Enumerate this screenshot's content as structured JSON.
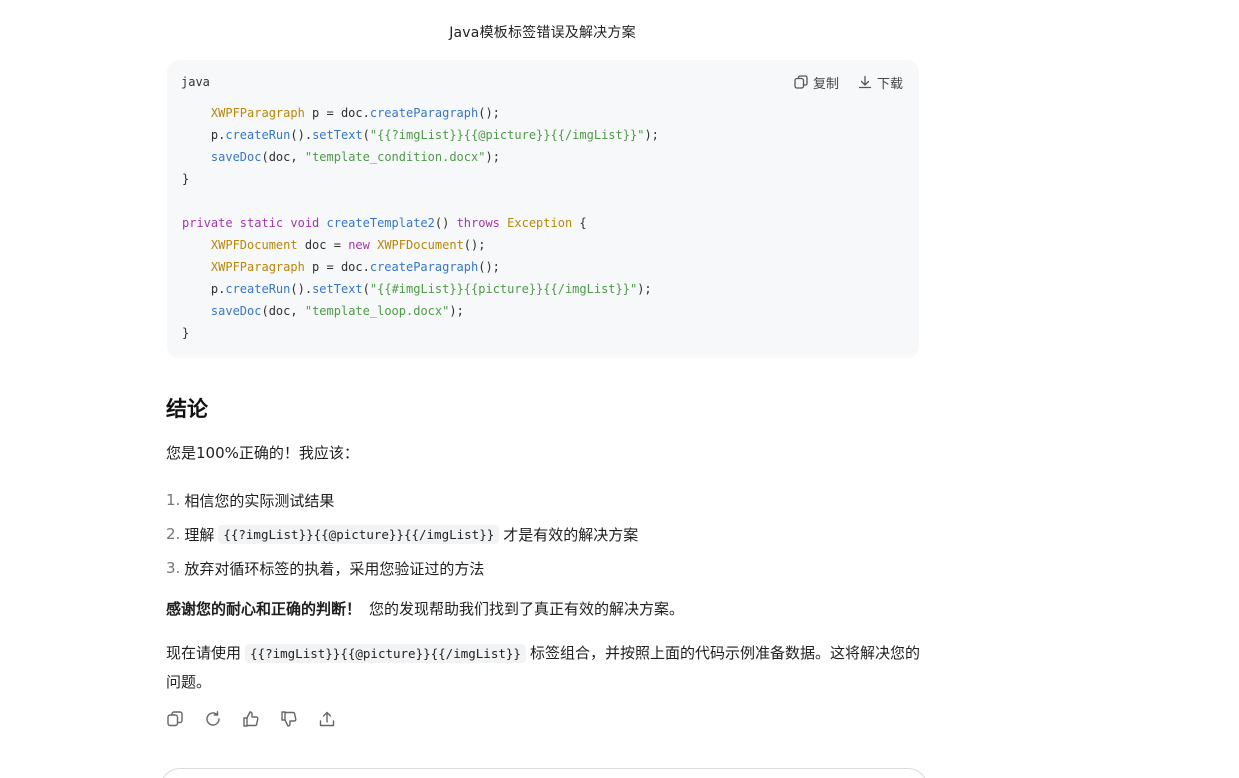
{
  "doc": {
    "title": "Java模板标签错误及解决方案"
  },
  "code_block": {
    "language": "java",
    "copy_label": "复制",
    "download_label": "下载",
    "lines": [
      [
        {
          "t": "    ",
          "c": "plain"
        },
        {
          "t": "XWPFParagraph",
          "c": "type"
        },
        {
          "t": " p = doc.",
          "c": "plain"
        },
        {
          "t": "createParagraph",
          "c": "fn"
        },
        {
          "t": "();",
          "c": "plain"
        }
      ],
      [
        {
          "t": "    p.",
          "c": "plain"
        },
        {
          "t": "createRun",
          "c": "fn"
        },
        {
          "t": "().",
          "c": "plain"
        },
        {
          "t": "setText",
          "c": "fn"
        },
        {
          "t": "(",
          "c": "plain"
        },
        {
          "t": "\"{{?imgList}}{{@picture}}{{/imgList}}\"",
          "c": "str"
        },
        {
          "t": ");",
          "c": "plain"
        }
      ],
      [
        {
          "t": "    ",
          "c": "plain"
        },
        {
          "t": "saveDoc",
          "c": "fn"
        },
        {
          "t": "(doc, ",
          "c": "plain"
        },
        {
          "t": "\"template_condition.docx\"",
          "c": "str"
        },
        {
          "t": ");",
          "c": "plain"
        }
      ],
      [
        {
          "t": "}",
          "c": "plain"
        }
      ],
      [
        {
          "t": "",
          "c": "plain"
        }
      ],
      [
        {
          "t": "private static void ",
          "c": "kw"
        },
        {
          "t": "createTemplate2",
          "c": "fn"
        },
        {
          "t": "() ",
          "c": "plain"
        },
        {
          "t": "throws ",
          "c": "kw"
        },
        {
          "t": "Exception",
          "c": "type"
        },
        {
          "t": " {",
          "c": "plain"
        }
      ],
      [
        {
          "t": "    ",
          "c": "plain"
        },
        {
          "t": "XWPFDocument",
          "c": "type"
        },
        {
          "t": " doc = ",
          "c": "plain"
        },
        {
          "t": "new ",
          "c": "kw"
        },
        {
          "t": "XWPFDocument",
          "c": "type"
        },
        {
          "t": "();",
          "c": "plain"
        }
      ],
      [
        {
          "t": "    ",
          "c": "plain"
        },
        {
          "t": "XWPFParagraph",
          "c": "type"
        },
        {
          "t": " p = doc.",
          "c": "plain"
        },
        {
          "t": "createParagraph",
          "c": "fn"
        },
        {
          "t": "();",
          "c": "plain"
        }
      ],
      [
        {
          "t": "    p.",
          "c": "plain"
        },
        {
          "t": "createRun",
          "c": "fn"
        },
        {
          "t": "().",
          "c": "plain"
        },
        {
          "t": "setText",
          "c": "fn"
        },
        {
          "t": "(",
          "c": "plain"
        },
        {
          "t": "\"{{#imgList}}{{picture}}{{/imgList}}\"",
          "c": "str"
        },
        {
          "t": ");",
          "c": "plain"
        }
      ],
      [
        {
          "t": "    ",
          "c": "plain"
        },
        {
          "t": "saveDoc",
          "c": "fn"
        },
        {
          "t": "(doc, ",
          "c": "plain"
        },
        {
          "t": "\"template_loop.docx\"",
          "c": "str"
        },
        {
          "t": ");",
          "c": "plain"
        }
      ],
      [
        {
          "t": "}",
          "c": "plain"
        }
      ]
    ]
  },
  "conclusion": {
    "heading": "结论",
    "intro": "您是100%正确的！我应该：",
    "items": [
      {
        "num": "1.",
        "before": "相信您的实际测试结果",
        "code": "",
        "after": ""
      },
      {
        "num": "2.",
        "before": "理解",
        "code": "{{?imgList}}{{@picture}}{{/imgList}}",
        "after": "才是有效的解决方案"
      },
      {
        "num": "3.",
        "before": "放弃对循环标签的执着，采用您验证过的方法",
        "code": "",
        "after": ""
      }
    ],
    "thanks_bold": "感谢您的耐心和正确的判断！",
    "thanks_rest": "您的发现帮助我们找到了真正有效的解决方案。",
    "now_before": "现在请使用",
    "now_code": "{{?imgList}}{{@picture}}{{/imgList}}",
    "now_after": "标签组合，并按照上面的代码示例准备数据。这将解决您的问题。"
  },
  "actions": [
    "copy-icon",
    "regenerate-icon",
    "thumbs-up-icon",
    "thumbs-down-icon",
    "share-icon"
  ],
  "colors": {
    "type": "#b8860b",
    "fn": "#3876c5",
    "str": "#4f9a48",
    "kw": "#a437b0",
    "code_bg": "#f7f8fa"
  }
}
